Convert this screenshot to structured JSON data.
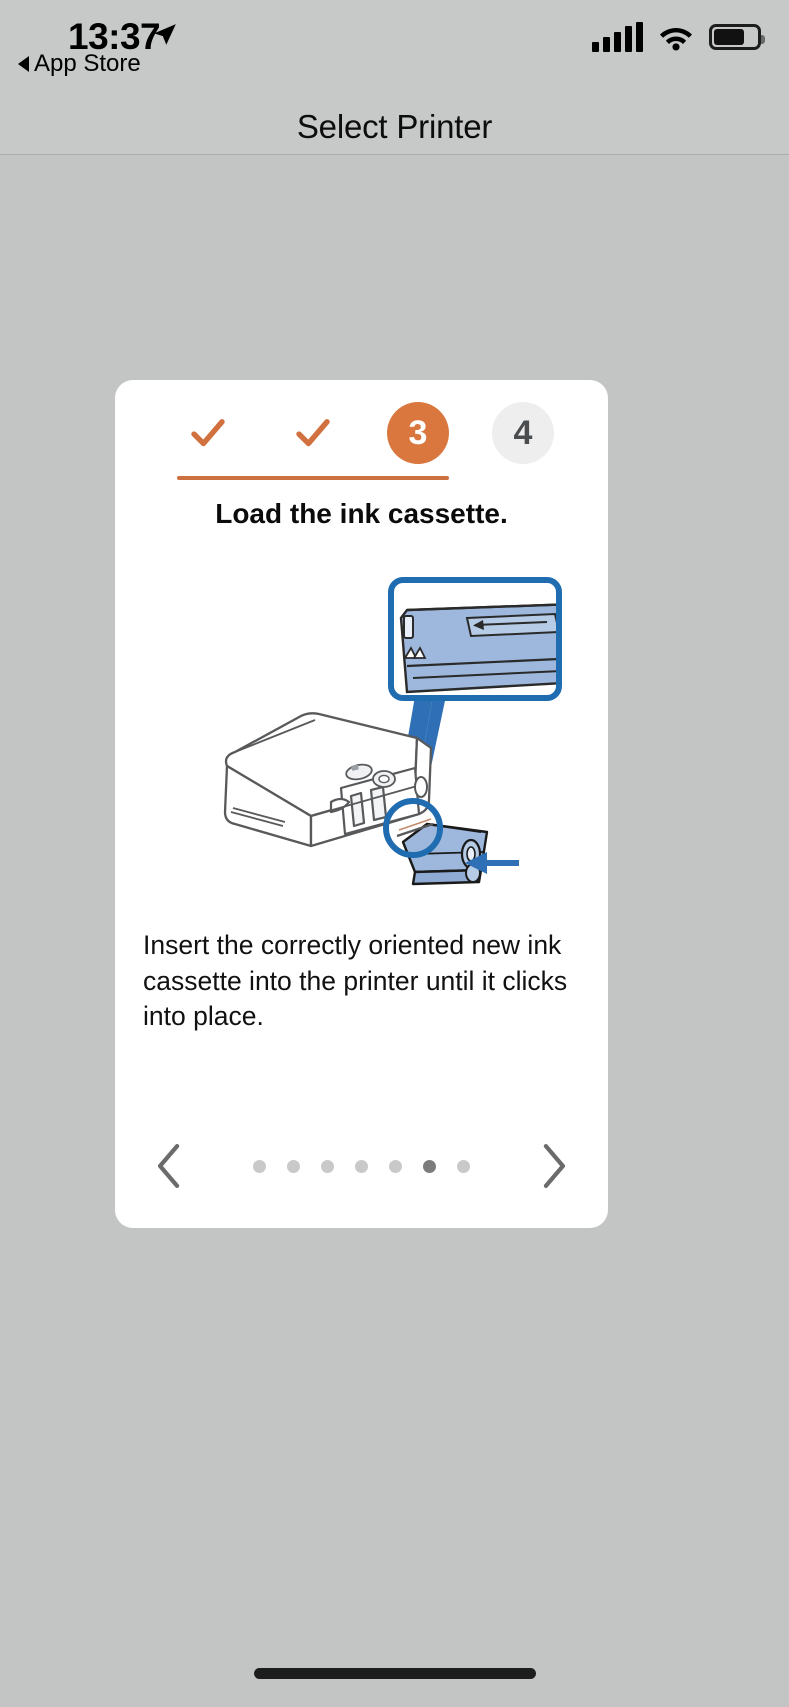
{
  "status_bar": {
    "time": "13:37",
    "location_icon": "location-arrow-icon",
    "back_label": "App Store",
    "cellular_icon": "cellular-signal-icon",
    "wifi_icon": "wifi-icon",
    "battery_icon": "battery-icon"
  },
  "nav_bar": {
    "title": "Select Printer"
  },
  "card": {
    "stepper": {
      "steps": [
        {
          "label": "",
          "state": "done",
          "icon": "check-icon"
        },
        {
          "label": "",
          "state": "done",
          "icon": "check-icon"
        },
        {
          "label": "3",
          "state": "current",
          "icon": ""
        },
        {
          "label": "4",
          "state": "upcoming",
          "icon": ""
        }
      ],
      "progress_color": "#cd7040",
      "current_color": "#d9773f",
      "upcoming_color": "#eeeeee"
    },
    "title": "Load the ink cassette.",
    "illustration": {
      "name": "printer-ink-cassette-illustration",
      "callout_color": "#1f6cb0",
      "cassette_color": "#9db8dc",
      "arrow_color": "#2f6fb5"
    },
    "body": "Insert the correctly oriented new ink cassette into the printer until it clicks into place.",
    "navigation": {
      "prev_icon": "chevron-left-icon",
      "next_icon": "chevron-right-icon",
      "dots_total": 7,
      "dots_active_index": 5
    }
  },
  "home_indicator": "home-indicator"
}
